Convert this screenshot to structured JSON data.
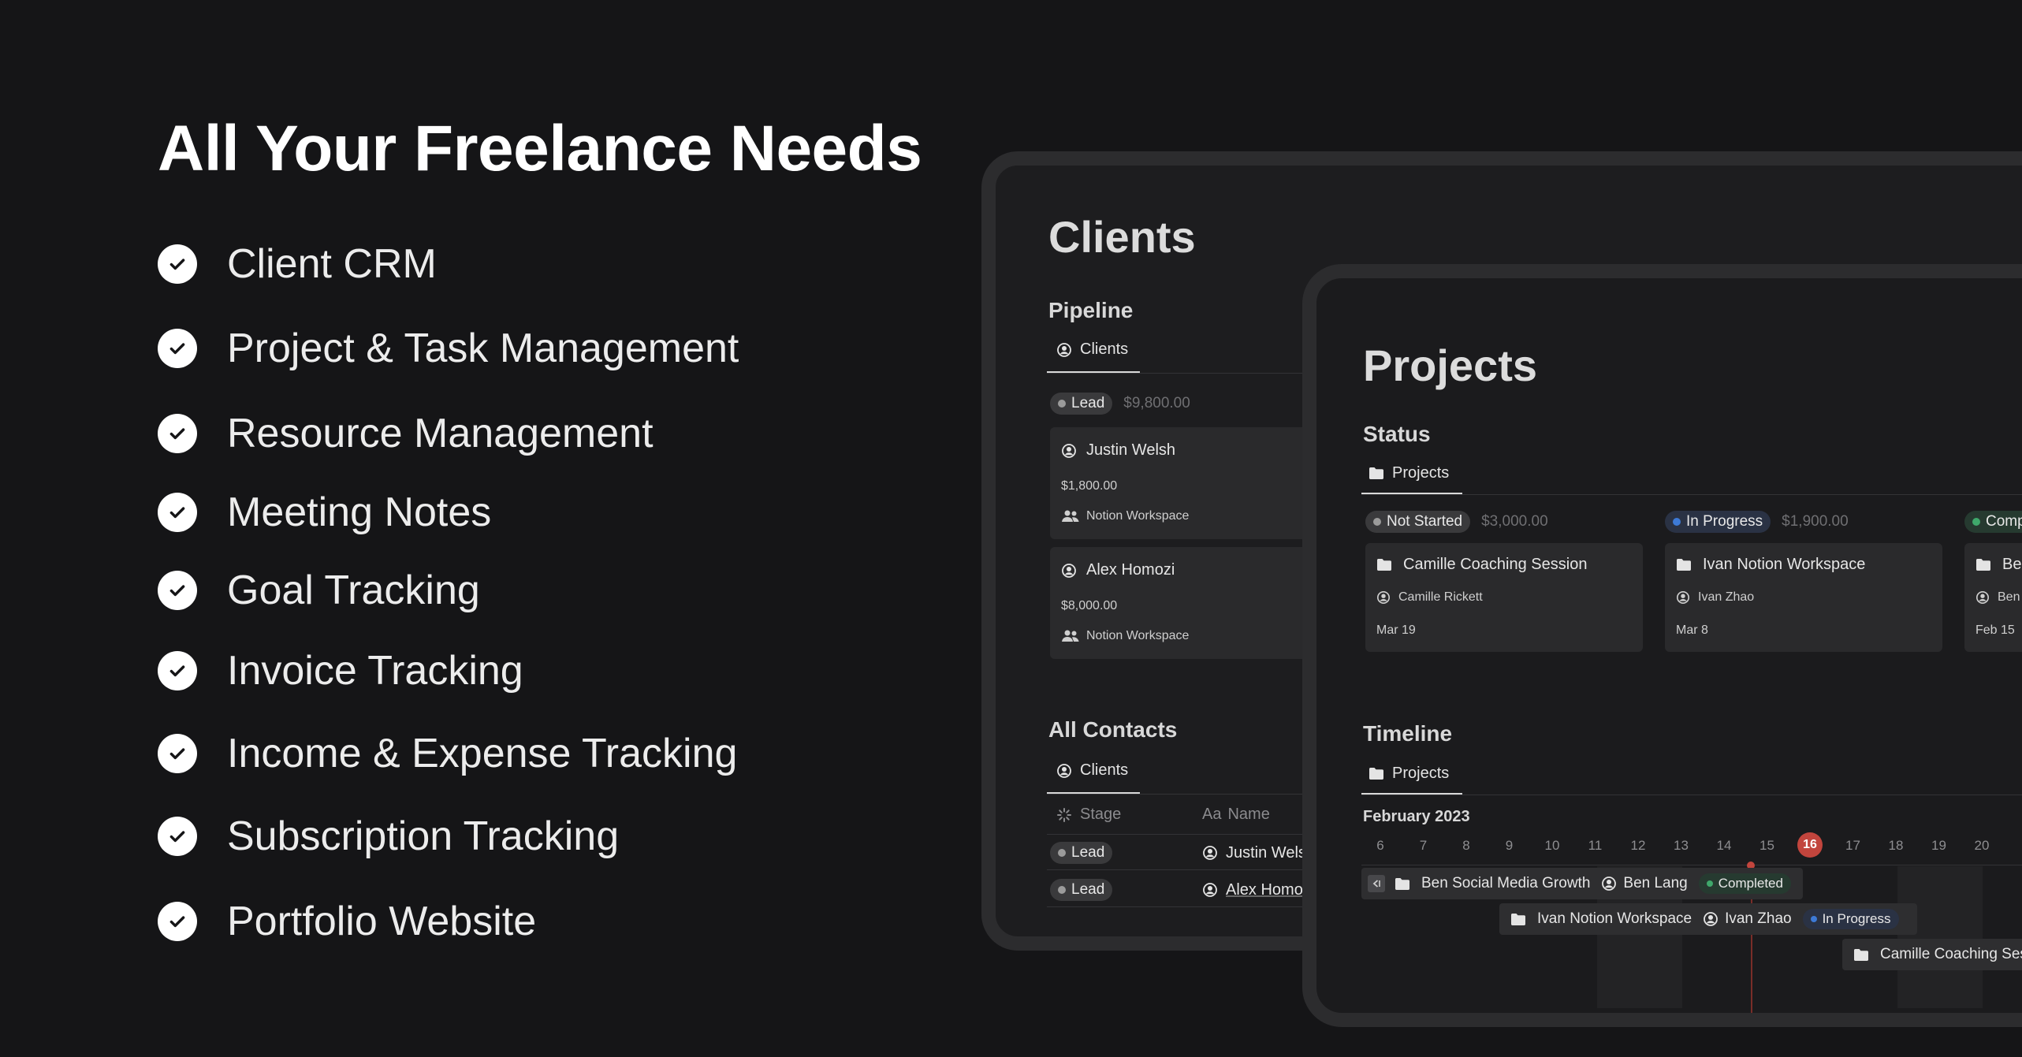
{
  "headline": "All Your Freelance Needs",
  "features": [
    "Client CRM",
    "Project & Task Management",
    "Resource Management",
    "Meeting Notes",
    "Goal Tracking",
    "Invoice Tracking",
    "Income & Expense Tracking",
    "Subscription Tracking",
    "Portfolio Website"
  ],
  "clients": {
    "title": "Clients",
    "pipeline": {
      "heading": "Pipeline",
      "tab": "Clients",
      "group": {
        "stage": "Lead",
        "total": "$9,800.00"
      },
      "cards": [
        {
          "name": "Justin Welsh",
          "amount": "$1,800.00",
          "project": "Notion Workspace"
        },
        {
          "name": "Alex Homozi",
          "amount": "$8,000.00",
          "project": "Notion Workspace"
        }
      ]
    },
    "contacts": {
      "heading": "All Contacts",
      "tab": "Clients",
      "columns": {
        "stage": "Stage",
        "name_prefix": "Aa",
        "name": "Name"
      },
      "rows": [
        {
          "stage": "Lead",
          "name": "Justin Welsh"
        },
        {
          "stage": "Lead",
          "name": "Alex Homozi"
        }
      ]
    }
  },
  "projects": {
    "title": "Projects",
    "status": {
      "heading": "Status",
      "tab": "Projects",
      "groups": [
        {
          "label": "Not Started",
          "total": "$3,000.00",
          "card": {
            "title": "Camille Coaching Session",
            "person": "Camille Rickett",
            "date": "Mar 19"
          }
        },
        {
          "label": "In Progress",
          "total": "$1,900.00",
          "card": {
            "title": "Ivan Notion Workspace",
            "person": "Ivan Zhao",
            "date": "Mar 8"
          }
        },
        {
          "label": "Completed",
          "total": "",
          "card": {
            "title": "Ben Social Media Growth",
            "person": "Ben Lang",
            "date": "Feb 15"
          }
        }
      ]
    },
    "timeline": {
      "heading": "Timeline",
      "tab": "Projects",
      "month": "February 2023",
      "days": [
        "6",
        "7",
        "8",
        "9",
        "10",
        "11",
        "12",
        "13",
        "14",
        "15",
        "16",
        "17",
        "18",
        "19",
        "20"
      ],
      "today": "16",
      "items": [
        {
          "title": "Ben Social Media Growth",
          "person": "Ben Lang",
          "status": "Completed"
        },
        {
          "title": "Ivan Notion Workspace",
          "person": "Ivan Zhao",
          "status": "In Progress"
        },
        {
          "title": "Camille Coaching Session",
          "person": "",
          "status": ""
        }
      ]
    }
  },
  "colors": {
    "background": "#151517",
    "lead_dot": "#9b9b9b",
    "not_started_dot": "#9b9b9b",
    "in_progress_dot": "#3d7ad6",
    "completed_dot": "#3fa86b",
    "today_marker": "#c2453d"
  },
  "icons": [
    "check-circle-icon",
    "user-circle-icon",
    "people-icon",
    "folder-icon",
    "loader-icon",
    "collapse-icon"
  ]
}
